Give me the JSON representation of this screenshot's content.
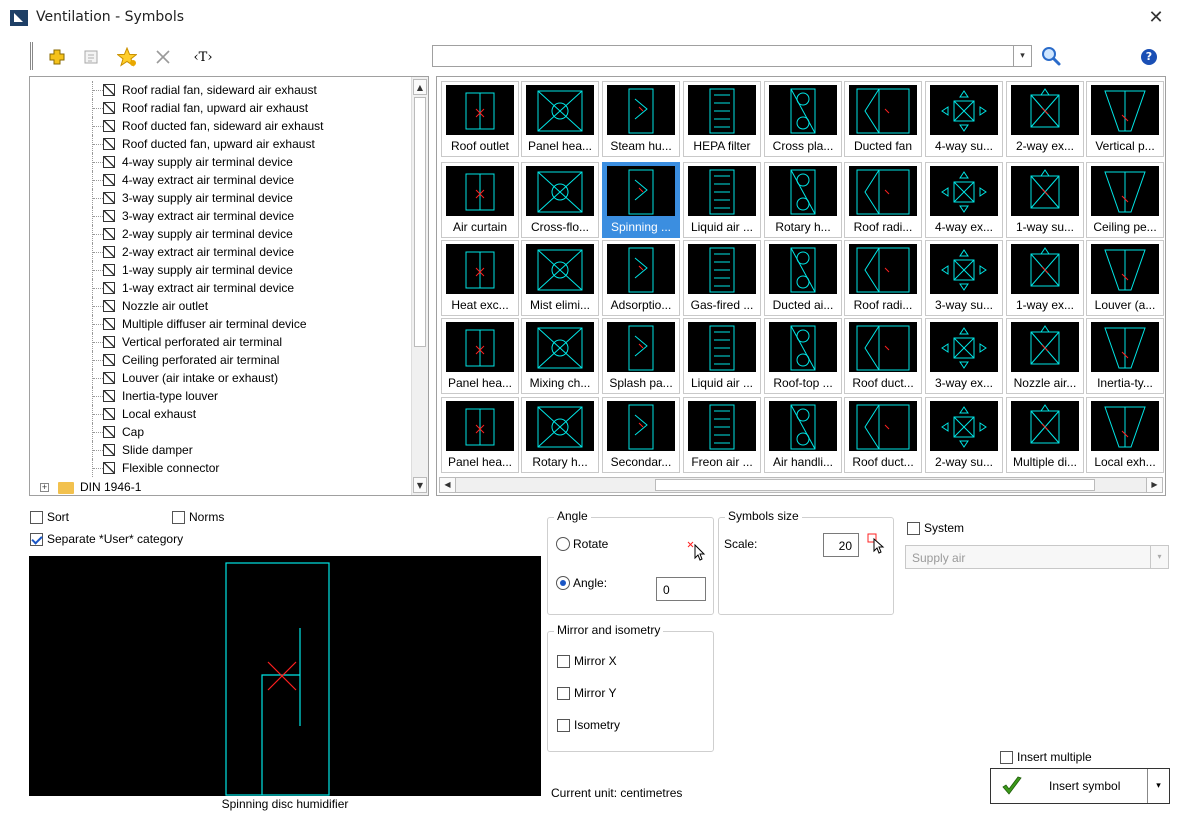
{
  "window": {
    "title": "Ventilation - Symbols",
    "close": "✕"
  },
  "search": {
    "value": "",
    "dropdown": "▾",
    "help": "?"
  },
  "tree": {
    "items": [
      "Roof radial fan, sideward air exhaust",
      "Roof radial fan, upward air exhaust",
      "Roof ducted fan, sideward air exhaust",
      "Roof ducted fan, upward air exhaust",
      "4-way supply air terminal device",
      "4-way extract air terminal device",
      "3-way supply air terminal device",
      "3-way extract air terminal device",
      "2-way supply air terminal device",
      "2-way extract air terminal device",
      "1-way supply air terminal device",
      "1-way extract air terminal device",
      "Nozzle air outlet",
      "Multiple diffuser air terminal device",
      "Vertical perforated air terminal",
      "Ceiling perforated air terminal",
      "Louver (air intake or exhaust)",
      "Inertia-type louver",
      "Local exhaust",
      "Cap",
      "Slide damper",
      "Flexible connector"
    ],
    "folder": {
      "label": "DIN 1946-1",
      "expander": "+"
    },
    "scroll_up": "▲",
    "scroll_down": "▼"
  },
  "symbols": [
    [
      "Roof outlet",
      "Panel hea...",
      "Steam hu...",
      "HEPA filter",
      "Cross pla...",
      "Ducted fan",
      "4-way su...",
      "2-way ex...",
      "Vertical p..."
    ],
    [
      "Air curtain",
      "Cross-flo...",
      "Spinning ...",
      "Liquid air ...",
      "Rotary h...",
      "Roof radi...",
      "4-way ex...",
      "1-way su...",
      "Ceiling pe..."
    ],
    [
      "Heat exc...",
      "Mist elimi...",
      "Adsorptio...",
      "Gas-fired ...",
      "Ducted ai...",
      "Roof radi...",
      "3-way su...",
      "1-way ex...",
      "Louver (a..."
    ],
    [
      "Panel hea...",
      "Mixing ch...",
      "Splash pa...",
      "Liquid air ...",
      "Roof-top ...",
      "Roof duct...",
      "3-way ex...",
      "Nozzle air...",
      "Inertia-ty..."
    ],
    [
      "Panel hea...",
      "Rotary h...",
      "Secondar...",
      "Freon air ...",
      "Air handli...",
      "Roof duct...",
      "2-way su...",
      "Multiple di...",
      "Local exh..."
    ]
  ],
  "selected_symbol": "Spinning ...",
  "hscroll": {
    "left": "◀",
    "right": "▶"
  },
  "options": {
    "sort": {
      "label": "Sort",
      "checked": false
    },
    "norms": {
      "label": "Norms",
      "checked": false
    },
    "separate_user": {
      "label": "Separate *User* category",
      "checked": true
    }
  },
  "preview": {
    "caption": "Spinning disc humidifier"
  },
  "angle": {
    "legend": "Angle",
    "rotate_label": "Rotate",
    "angle_label": "Angle:",
    "angle_value": "0",
    "selected": "angle"
  },
  "symbols_size": {
    "legend": "Symbols size",
    "scale_label": "Scale:",
    "scale_value": "20"
  },
  "mirror": {
    "legend": "Mirror and isometry",
    "mirror_x": "Mirror X",
    "mirror_y": "Mirror Y",
    "isometry": "Isometry"
  },
  "system": {
    "label": "System",
    "value": "Supply air",
    "dropdown": "▾"
  },
  "status": {
    "unit": "Current unit: centimetres"
  },
  "insert": {
    "multiple_label": "Insert multiple",
    "button_label": "Insert symbol",
    "arrow": "▾"
  },
  "colors": {
    "symbol_line": "#00e5e5",
    "symbol_mark": "#ff2020",
    "selection": "#3b8ee0",
    "thumb_bg": "#000000"
  }
}
